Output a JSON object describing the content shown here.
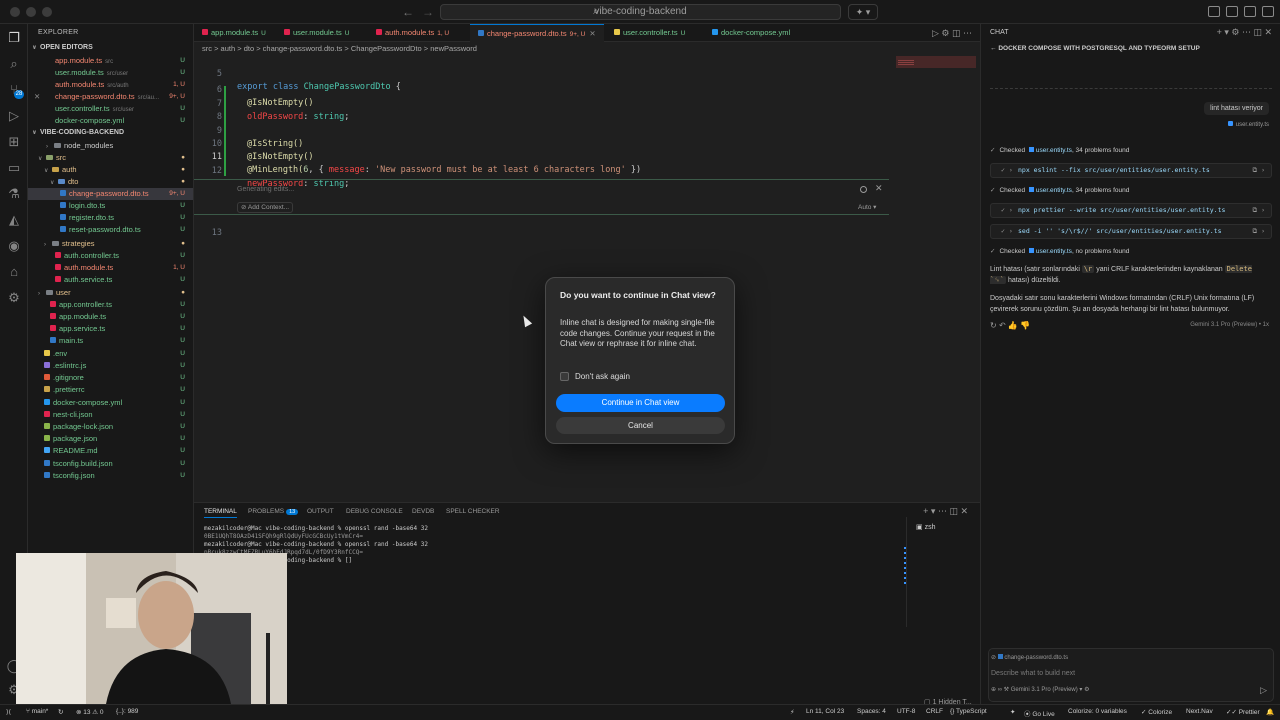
{
  "titlebar": {
    "search_text": "vibe-coding-backend"
  },
  "explorer": {
    "header": "EXPLORER",
    "open_editors_label": "OPEN EDITORS",
    "project_label": "VIBE-CODING-BACKEND",
    "open_editors": [
      {
        "name": "app.module.ts",
        "path": "src",
        "status": "U"
      },
      {
        "name": "user.module.ts",
        "path": "src/user",
        "status": "U"
      },
      {
        "name": "auth.module.ts",
        "path": "src/auth",
        "status": "1, U"
      },
      {
        "name": "change-password.dto.ts",
        "path": "src/au...",
        "status": "9+, U"
      },
      {
        "name": "user.controller.ts",
        "path": "src/user",
        "status": "U"
      },
      {
        "name": "docker-compose.yml",
        "path": "",
        "status": "U"
      }
    ],
    "tree": [
      {
        "name": "node_modules",
        "status": ""
      },
      {
        "name": "src",
        "status": "●"
      },
      {
        "name": "auth",
        "status": "●"
      },
      {
        "name": "dto",
        "status": "●"
      },
      {
        "name": "change-password.dto.ts",
        "status": "9+, U"
      },
      {
        "name": "login.dto.ts",
        "status": "U"
      },
      {
        "name": "register.dto.ts",
        "status": "U"
      },
      {
        "name": "reset-password.dto.ts",
        "status": "U"
      },
      {
        "name": "strategies",
        "status": "●"
      },
      {
        "name": "auth.controller.ts",
        "status": "U"
      },
      {
        "name": "auth.module.ts",
        "status": "1, U"
      },
      {
        "name": "auth.service.ts",
        "status": "U"
      },
      {
        "name": "user",
        "status": "●"
      },
      {
        "name": "app.controller.ts",
        "status": "U"
      },
      {
        "name": "app.module.ts",
        "status": "U"
      },
      {
        "name": "app.service.ts",
        "status": "U"
      },
      {
        "name": "main.ts",
        "status": "U"
      },
      {
        "name": ".env",
        "status": "U"
      },
      {
        "name": ".eslintrc.js",
        "status": "U"
      },
      {
        "name": ".gitignore",
        "status": "U"
      },
      {
        "name": ".prettierrc",
        "status": "U"
      },
      {
        "name": "docker-compose.yml",
        "status": "U"
      },
      {
        "name": "nest-cli.json",
        "status": "U"
      },
      {
        "name": "package-lock.json",
        "status": "U"
      },
      {
        "name": "package.json",
        "status": "U"
      },
      {
        "name": "README.md",
        "status": "U"
      },
      {
        "name": "tsconfig.build.json",
        "status": "U"
      },
      {
        "name": "tsconfig.json",
        "status": "U"
      }
    ]
  },
  "editor": {
    "tabs": [
      {
        "name": "app.module.ts",
        "status": "U"
      },
      {
        "name": "user.module.ts",
        "status": "U"
      },
      {
        "name": "auth.module.ts",
        "status": "1, U"
      },
      {
        "name": "change-password.dto.ts",
        "status": "9+, U"
      },
      {
        "name": "user.controller.ts",
        "status": "U"
      },
      {
        "name": "docker-compose.yml",
        "status": ""
      }
    ],
    "breadcrumb": "src > auth > dto > change-password.dto.ts > ChangePasswordDto > newPassword",
    "lines": {
      "n5": "5",
      "n6": "6",
      "n7": "7",
      "n8": "8",
      "n9": "9",
      "n10": "10",
      "n11": "11",
      "n12": "12",
      "n13": "13",
      "kw_export": "export",
      "kw_class": "class",
      "class_name": "ChangePasswordDto",
      "brace_open": "{",
      "dec_isnotempty": "@IsNotEmpty()",
      "prop_old": "oldPassword",
      "type_string": "string",
      "dec_isstring": "@IsString()",
      "dec_minlength": "@MinLength(",
      "num_6": "6",
      "msg_key": "message",
      "msg_val": "'New password must be at least 6 characters long'",
      "prop_new": "newPassword"
    },
    "inline_chat": {
      "generating": "Generating edits...",
      "add_context": "Add Context...",
      "mode": "Auto"
    }
  },
  "dialog": {
    "title": "Do you want to continue in Chat view?",
    "body": "Inline chat is designed for making single-file code changes. Continue your request in the Chat view or rephrase it for inline chat.",
    "checkbox_label": "Don't ask again",
    "primary_button": "Continue in Chat view",
    "cancel_button": "Cancel"
  },
  "panel": {
    "tabs": [
      "TERMINAL",
      "PROBLEMS",
      "OUTPUT",
      "DEBUG CONSOLE",
      "DEVDB",
      "SPELL CHECKER"
    ],
    "problems_count": "13",
    "terminal_lines": [
      "mezakilcoder@Mac vibe-coding-backend % openssl rand -base64 32",
      "0BE1UQhT8OAzD41SFQh9gRlQdUyFUcGCBcUy1tVmCr4=",
      "mezakilcoder@Mac vibe-coding-backend % openssl rand -base64 32",
      "pRcuk8zzwCtMFZRLuY6hEdJRpqd7dL/0fD9Y3RnfCCQ=",
      "mezakilcoder@Mac vibe-coding-backend % []"
    ],
    "terminal_name": "zsh",
    "hidden_terminals": "1 Hidden T..."
  },
  "chat": {
    "header": "CHAT",
    "title": "DOCKER COMPOSE WITH POSTGRESQL AND TYPEORM SETUP",
    "user_message": "lint hatası veriyor",
    "user_attachment": "user.entity.ts",
    "steps": [
      {
        "kind": "check",
        "prefix": "Checked",
        "file": "user.entity.ts",
        "suffix": ", 34 problems found"
      },
      {
        "kind": "cmd",
        "text": "npx eslint --fix src/user/entities/user.entity.ts"
      },
      {
        "kind": "check",
        "prefix": "Checked",
        "file": "user.entity.ts",
        "suffix": ", 34 problems found"
      },
      {
        "kind": "cmd",
        "text": "npx prettier --write src/user/entities/user.entity.ts"
      },
      {
        "kind": "cmd",
        "text": "sed -i '' 's/\\r$//' src/user/entities/user.entity.ts"
      },
      {
        "kind": "check",
        "prefix": "Checked",
        "file": "user.entity.ts",
        "suffix": ", no problems found"
      }
    ],
    "response_p1_a": "Lint hatası (satır sonlarındaki",
    "response_p1_code1": "\\r",
    "response_p1_b": "yani CRLF karakterlerinden kaynaklanan",
    "response_p1_code2": "Delete `␍`",
    "response_p1_c": "hatası) düzeltildi.",
    "response_p2": "Dosyadaki satır sonu karakterlerini Windows formatından (CRLF) Unix formatına (LF) çevirerek sorunu çözdüm. Şu an dosyada herhangi bir lint hatası bulunmuyor.",
    "response_model": "Gemini 3.1 Pro (Preview) • 1x",
    "input_context": "change-password.dto.ts",
    "input_placeholder": "Describe what to build next",
    "input_model": "Gemini 3.1 Pro (Preview)"
  },
  "statusbar": {
    "branch": "main*",
    "problems": "⊗ 13 ⚠ 0",
    "selection": "{..}: 989",
    "position": "Ln 11, Col 23",
    "spaces": "Spaces: 4",
    "encoding": "UTF-8",
    "eol": "CRLF",
    "language": "TypeScript",
    "golive": "Go Live",
    "colorize": "Colorize: 0 variables",
    "colorize2": "Colorize",
    "nextnav": "Next.Nav",
    "prettier": "Prettier"
  }
}
